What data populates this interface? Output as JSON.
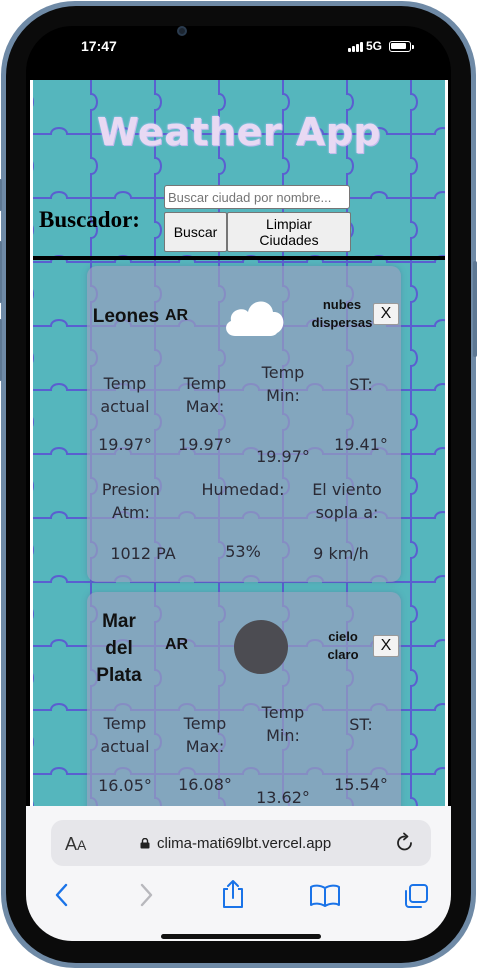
{
  "status_bar": {
    "time": "17:47",
    "network": "5G"
  },
  "app": {
    "title": "Weather App",
    "search": {
      "label": "Buscador:",
      "placeholder": "Buscar ciudad por nombre...",
      "search_button": "Buscar",
      "clear_button_line1": "Limpiar",
      "clear_button_line2": "Ciudades"
    }
  },
  "cards": [
    {
      "city_lines": [
        "Leones"
      ],
      "country": "AR",
      "icon": "cloud-icon",
      "description_lines": [
        "nubes",
        "dispersas"
      ],
      "close_label": "X",
      "labels": {
        "temp_actual": [
          "Temp",
          "actual"
        ],
        "temp_max": [
          "Temp",
          "Max:"
        ],
        "temp_min": [
          "Temp",
          "Min:"
        ],
        "st": [
          "ST:"
        ],
        "presion": [
          "Presion",
          "Atm:"
        ],
        "humedad": [
          "Humedad:"
        ],
        "viento": [
          "El viento",
          "sopla a:"
        ]
      },
      "values": {
        "temp_actual": "19.97°",
        "temp_max": "19.97°",
        "temp_min": "19.97°",
        "st": "19.41°",
        "presion": "1012 PA",
        "humedad": "53%",
        "viento": "9 km/h"
      }
    },
    {
      "city_lines": [
        "Mar",
        "del",
        "Plata"
      ],
      "country": "AR",
      "icon": "moon-icon",
      "description_lines": [
        "cielo",
        "claro"
      ],
      "close_label": "X",
      "labels": {
        "temp_actual": [
          "Temp",
          "actual"
        ],
        "temp_max": [
          "Temp",
          "Max:"
        ],
        "temp_min": [
          "Temp",
          "Min:"
        ],
        "st": [
          "ST:"
        ]
      },
      "values": {
        "temp_actual": "16.05°",
        "temp_max": "16.08°",
        "temp_min": "13.62°",
        "st": "15.54°"
      }
    }
  ],
  "browser": {
    "text_size_label": "AA",
    "url": "clima-mati69lbt.vercel.app"
  },
  "colors": {
    "page_background": "#55b6bd",
    "puzzle_lines": "#5a5fd0",
    "card": "#96a0be"
  }
}
